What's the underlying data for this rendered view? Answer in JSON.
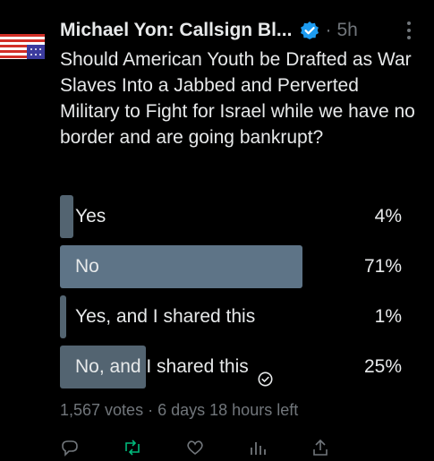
{
  "post": {
    "author_name": "Michael Yon: Callsign Bl...",
    "separator": "·",
    "time_ago": "5h",
    "text": "Should American Youth be Drafted as War Slaves Into a Jabbed and Perverted Military to Fight for Israel while we have no border and are going bankrupt?",
    "verified_color": "#1d9bf0",
    "avatar_icon": "us-flag-icon",
    "more_icon": "more-vertical-icon"
  },
  "poll": {
    "options": [
      {
        "label": "Yes",
        "percent_text": "4%",
        "share": 0.04,
        "selected": false
      },
      {
        "label": "No",
        "percent_text": "71%",
        "share": 0.71,
        "selected": false
      },
      {
        "label": "Yes, and I shared this",
        "percent_text": "1%",
        "share": 0.01,
        "selected": false
      },
      {
        "label": "No, and I shared this",
        "percent_text": "25%",
        "share": 0.25,
        "selected": true
      }
    ],
    "votes": "1,567 votes",
    "dot": "·",
    "time_left": "6 days 18 hours left",
    "bar_color": "#536471",
    "leader_bar_color": "#5e7487"
  },
  "actions": [
    "reply-icon",
    "repost-icon",
    "like-icon",
    "views-icon",
    "share-icon"
  ]
}
